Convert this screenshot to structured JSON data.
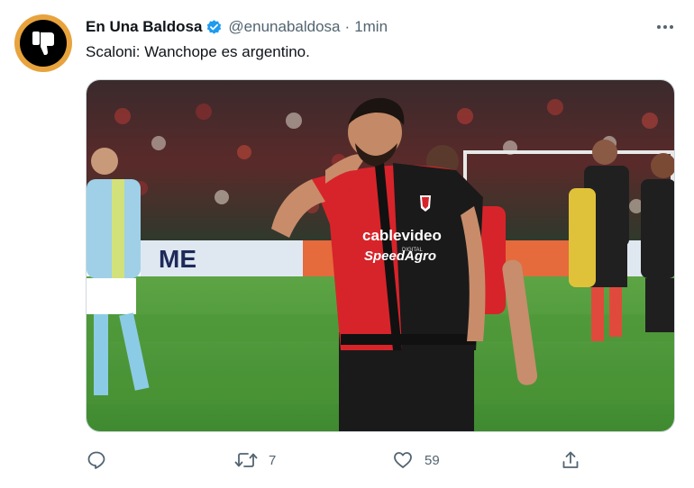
{
  "tweet": {
    "display_name": "En Una Baldosa",
    "handle": "@enunabaldosa",
    "separator": "·",
    "time": "1min",
    "text": "Scaloni: Wanchope es argentino.",
    "image": {
      "jersey_sponsor_1": "cablevideo",
      "jersey_sponsor_1_sub": "DIGITAL",
      "jersey_sponsor_2": "SpeedAgro",
      "billboard_text": "ME"
    },
    "actions": {
      "reply_icon": "reply-icon",
      "retweet_icon": "retweet-icon",
      "retweet_count": "7",
      "like_icon": "heart-icon",
      "like_count": "59",
      "share_icon": "share-icon"
    },
    "colors": {
      "avatar_ring": "#e8a33d",
      "verified": "#1d9bf0",
      "secondary_text": "#536471",
      "jersey_red": "#d7242a",
      "jersey_black": "#1a1a1a",
      "pitch_green": "#4f9a3a"
    }
  }
}
